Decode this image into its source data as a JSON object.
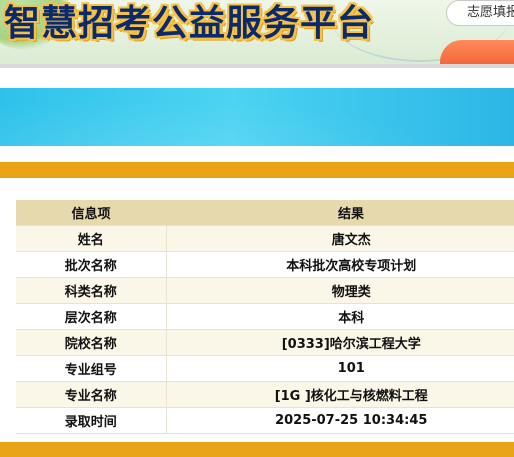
{
  "header": {
    "title": "智慧招考公益服务平台",
    "nav_tab_label": "志愿填报"
  },
  "colors": {
    "title_text": "#0b2a6c",
    "title_outline": "#f5c146",
    "banner": "#3ccbf0",
    "accent_orange": "#e8a317",
    "button_orange": "#ef5a2e",
    "table_header": "#e6d9ae",
    "table_row_alt": "#fbf7e8"
  },
  "result_table": {
    "headers": [
      "信息项",
      "结果"
    ],
    "rows": [
      {
        "key": "姓名",
        "value": "唐文杰"
      },
      {
        "key": "批次名称",
        "value": "本科批次高校专项计划"
      },
      {
        "key": "科类名称",
        "value": "物理类"
      },
      {
        "key": "层次名称",
        "value": "本科"
      },
      {
        "key": "院校名称",
        "value": "[0333]哈尔滨工程大学"
      },
      {
        "key": "专业组号",
        "value": "101"
      },
      {
        "key": "专业名称",
        "value": "[1G ]核化工与核燃料工程"
      },
      {
        "key": "录取时间",
        "value": "2025-07-25 10:34:45"
      }
    ]
  }
}
